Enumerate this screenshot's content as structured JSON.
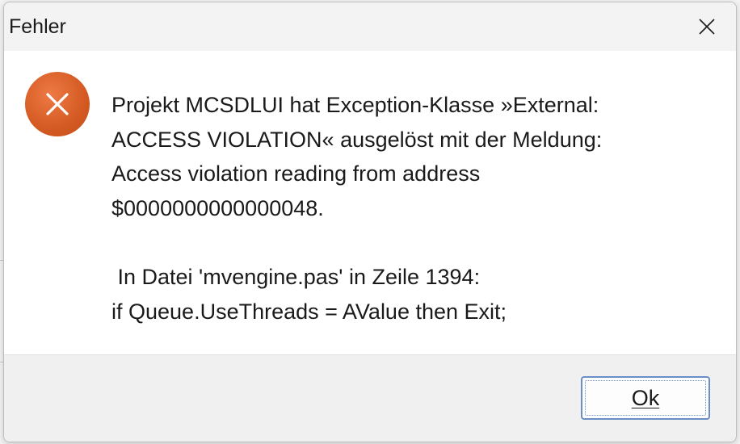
{
  "dialog": {
    "title": "Fehler",
    "icon": "error-x-icon",
    "message_lines": [
      "Projekt MCSDLUI hat Exception-Klasse »External:",
      "ACCESS VIOLATION« ausgelöst mit der Meldung:",
      "Access violation reading from address",
      "$0000000000000048.",
      "",
      " In Datei 'mvengine.pas' in Zeile 1394:",
      "if Queue.UseThreads = AValue then Exit;"
    ],
    "ok_label": "Ok",
    "close_icon": "close-icon"
  },
  "colors": {
    "error_icon": "#d45a22",
    "button_border": "#6a8fc7",
    "titlebar": "#f3f3f3",
    "footer": "#f0f0f0"
  }
}
